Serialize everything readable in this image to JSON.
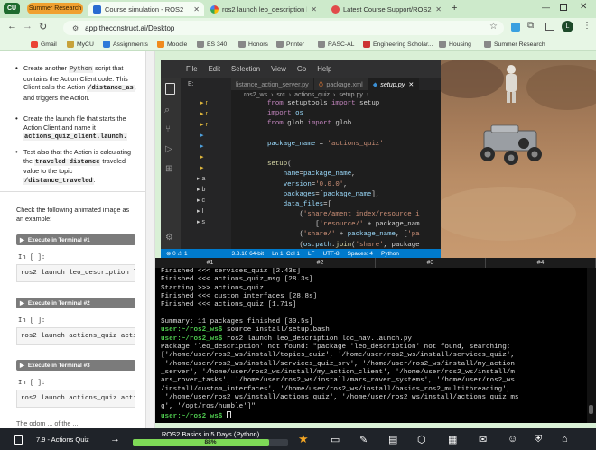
{
  "browser": {
    "tabs": [
      {
        "label": "Summer Research",
        "type": "group"
      },
      {
        "label": "Course simulation - ROS2"
      },
      {
        "label": "ros2 launch leo_description loc"
      },
      {
        "label": "Latest Course Support/ROS2 Basic"
      }
    ],
    "profile_badge": "CU",
    "url": "app.theconstruct.ai/Desktop",
    "bookmarks": [
      "Gmail",
      "MyCU",
      "Assignments",
      "Moodle",
      "ES 340",
      "Honors",
      "Printer",
      "RASC-AL",
      "Engineering Scholar...",
      "Housing",
      "Summer Research"
    ],
    "avatar_letter": "L"
  },
  "notebook": {
    "items": [
      {
        "text_a": "Create another ",
        "code": "Python",
        "text_b": " script that contains the Action Client code. This Client calls the Action ",
        "code2": "/distance_as",
        "text_c": ", and triggers the Action."
      },
      {
        "text_a": "Create the launch file that starts the Action Client and name it ",
        "code": "actions_quiz_client.launch.",
        "text_b": ""
      },
      {
        "text_a": "Test also that the Action is calculating the ",
        "code": "traveled distance",
        "text_b": " traveled value to the topic ",
        "code2": "/distance_traveled",
        "text_c": "."
      }
    ],
    "intro": "Check the following animated image as an example:",
    "cells": [
      {
        "button": "Execute in Terminal #1",
        "prompt": "In [ ]:",
        "code": "ros2 launch leo_description l"
      },
      {
        "button": "Execute in Terminal #2",
        "prompt": "In [ ]:",
        "code": "ros2 launch actions_quiz acti"
      },
      {
        "button": "Execute in Terminal #3",
        "prompt": "In [ ]:",
        "code": "ros2 launch actions_quiz acti"
      }
    ],
    "footer_text": "The odom ... of the ..."
  },
  "vscode": {
    "menu": [
      "File",
      "Edit",
      "Selection",
      "View",
      "Go",
      "Help"
    ],
    "tabs": [
      "E:",
      "listance_action_server.py",
      "package.xml",
      "setup.py"
    ],
    "breadcrumb": [
      "ros2_ws",
      "src",
      "actions_quiz",
      "setup.py",
      "..."
    ],
    "explorer_items": [
      "r",
      "r",
      "r",
      "a",
      "b",
      "c",
      "I",
      "s"
    ],
    "code_lines": [
      "from setuptools import setup",
      "import os",
      "from glob import glob",
      "",
      "package_name = 'actions_quiz'",
      "",
      "setup(",
      "    name=package_name,",
      "    version='0.0.0',",
      "    packages=[package_name],",
      "    data_files=[",
      "        ('share/ament_index/resource_i",
      "            ['resource/' + package_nam",
      "        ('share/' + package_name, ['pa",
      "        (os.path.join('share', package",
      "    ],",
      "    install_requires=['setuptools'],"
    ],
    "status": [
      "⊗ 0 ⚠ 1",
      "3.8.10 64-bit",
      "Ln 1, Col 1",
      "LF",
      "UTF-8",
      "Spaces: 4",
      "Python"
    ]
  },
  "terminal": {
    "tabs": [
      "#1",
      "#2",
      "#3",
      "#4"
    ],
    "lines": [
      {
        "t": "Finished <<< services_quiz [2.43s]"
      },
      {
        "t": "Finished <<< actions_quiz_msg [28.3s]"
      },
      {
        "t": "Starting >>> actions_quiz"
      },
      {
        "t": "Finished <<< custom_interfaces [28.8s]"
      },
      {
        "t": "Finished <<< actions_quiz [1.71s]"
      },
      {
        "t": ""
      },
      {
        "t": "Summary: 11 packages finished [30.5s]"
      },
      {
        "p": "user:~/ros2_ws$",
        "t": " source install/setup.bash"
      },
      {
        "p": "user:~/ros2_ws$",
        "t": " ros2 launch leo_description loc_nav.launch.py"
      },
      {
        "t": "Package 'leo_description' not found: \"package 'leo_description' not found, searching:"
      },
      {
        "t": "['/home/user/ros2_ws/install/topics_quiz', '/home/user/ros2_ws/install/services_quiz',"
      },
      {
        "t": " '/home/user/ros2_ws/install/services_quiz_srv', '/home/user/ros2_ws/install/my_action"
      },
      {
        "t": "_server', '/home/user/ros2_ws/install/my_action_client', '/home/user/ros2_ws/install/m"
      },
      {
        "t": "ars_rover_tasks', '/home/user/ros2_ws/install/mars_rover_systems', '/home/user/ros2_ws"
      },
      {
        "t": "/install/custom_interfaces', '/home/user/ros2_ws/install/basics_ros2_multithreading',"
      },
      {
        "t": " '/home/user/ros2_ws/install/actions_quiz', '/home/user/ros2_ws/install/actions_quiz_ms"
      },
      {
        "t": "g', '/opt/ros/humble']\""
      },
      {
        "p": "user:~/ros2_ws$",
        "t": " "
      }
    ]
  },
  "bottom": {
    "lesson": "7.9 - Actions Quiz",
    "course": "ROS2 Basics in 5 Days (Python)",
    "progress_label": "88%",
    "progress": 0.88
  }
}
